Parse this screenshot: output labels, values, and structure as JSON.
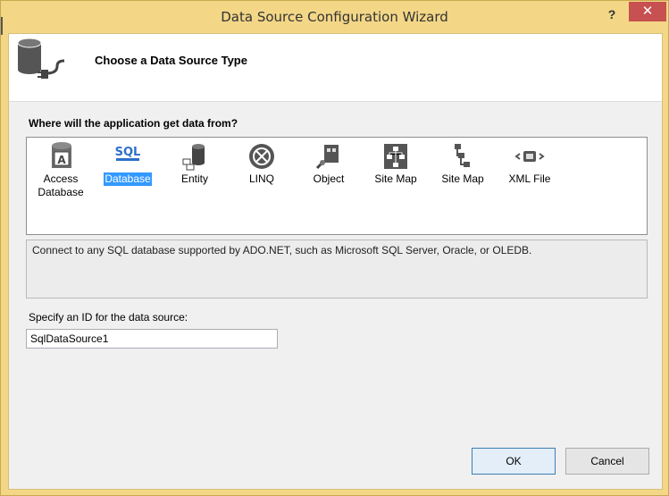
{
  "window": {
    "title": "Data Source Configuration Wizard",
    "help_label": "?",
    "close_label": "✕"
  },
  "header": {
    "title": "Choose a Data Source Type",
    "icon": "database-plug-icon"
  },
  "sources": {
    "question": "Where will the application get data from?",
    "items": [
      {
        "label": "Access\nDatabase",
        "icon": "access-database-icon"
      },
      {
        "label": "Database",
        "icon": "sql-database-icon",
        "selected": true
      },
      {
        "label": "Entity",
        "icon": "entity-icon"
      },
      {
        "label": "LINQ",
        "icon": "linq-icon"
      },
      {
        "label": "Object",
        "icon": "object-icon"
      },
      {
        "label": "Site Map",
        "icon": "site-map-icon"
      },
      {
        "label": "Site Map",
        "icon": "site-map-alt-icon"
      },
      {
        "label": "XML File",
        "icon": "xml-file-icon"
      }
    ],
    "description": "Connect to any SQL database supported by ADO.NET, such as Microsoft SQL Server, Oracle, or OLEDB."
  },
  "id_field": {
    "label": "Specify an ID for the data source:",
    "value": "SqlDataSource1"
  },
  "buttons": {
    "ok": "OK",
    "cancel": "Cancel"
  },
  "colors": {
    "title_bar": "#f3d787",
    "close": "#c75050",
    "selection": "#3399ff"
  }
}
